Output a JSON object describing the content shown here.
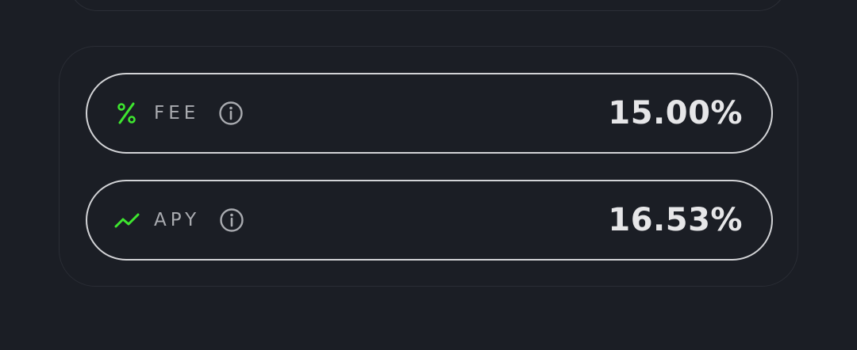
{
  "stats": {
    "fee": {
      "icon": "percent-icon",
      "label": "FEE",
      "value": "15.00%"
    },
    "apy": {
      "icon": "trending-up-icon",
      "label": "APY",
      "value": "16.53%"
    }
  },
  "colors": {
    "background": "#1b1e25",
    "accent": "#3ee62f",
    "pill_border": "#d2d3d6",
    "label": "#a9abb0",
    "value": "#e6e6e8"
  }
}
